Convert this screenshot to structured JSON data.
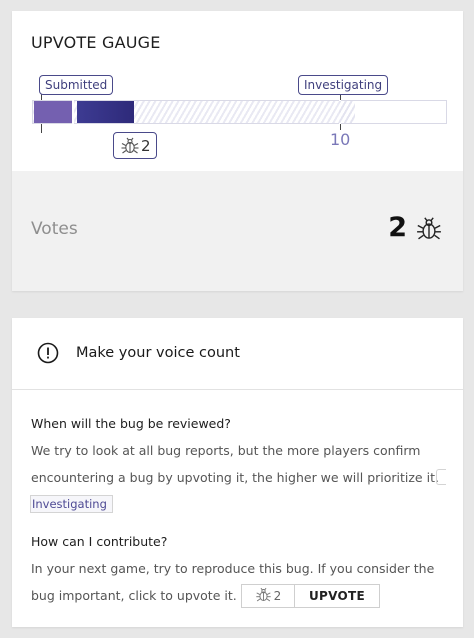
{
  "gauge": {
    "title": "UPVOTE GAUGE",
    "milestones": [
      {
        "label": "Submitted"
      },
      {
        "label": "Investigating"
      }
    ],
    "current_votes": "2",
    "investigating_threshold": "10",
    "progress_fraction": 0.2,
    "votes_label": "Votes",
    "votes_count": "2",
    "icon": "bug-icon",
    "colors": {
      "bar_primary": "#2e2a7a",
      "bar_secondary": "#7460b0",
      "tag_border": "#4a4a8a",
      "threshold_text": "#7a78b8"
    }
  },
  "info": {
    "title": "Make your voice count",
    "icon": "exclamation-circle-icon",
    "q1": "When will the bug be reviewed?",
    "a1_line1": "We try to look at all bug reports, but the more players confirm",
    "a1_line2": "encountering a bug by upvoting it, the higher we will prioritize it.",
    "a1_tag": "Investigating",
    "q2": "How can I contribute?",
    "a2_line1": "In your next game, try to reproduce this bug. If you consider the",
    "a2_line2": "bug important, click to upvote it.",
    "upvote_count": "2",
    "upvote_label": "UPVOTE"
  }
}
